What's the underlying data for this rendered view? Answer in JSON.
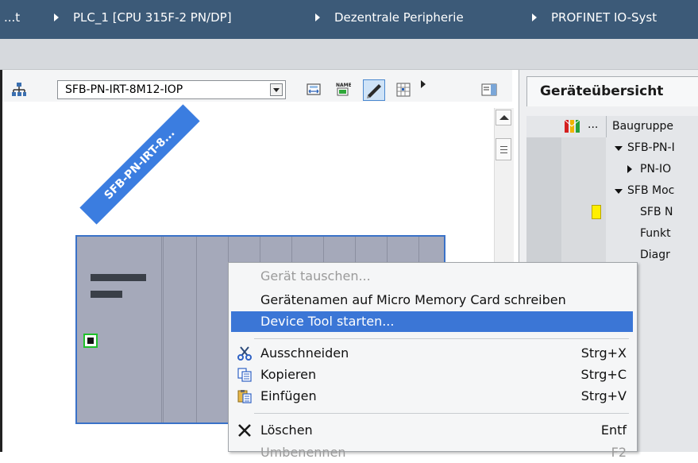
{
  "breadcrumb": {
    "items": [
      "...t",
      "PLC_1 [CPU 315F-2 PN/DP]",
      "Dezentrale Peripherie",
      "PROFINET IO-Syst"
    ]
  },
  "toolbar": {
    "device_select_value": "SFB-PN-IRT-8M12-IOP",
    "icons": [
      "network-view-icon",
      "device-select-icon",
      "zoom-fit-icon",
      "show-name-icon",
      "edit-icon",
      "grid-icon",
      "expand-arrow-icon",
      "panel-toggle-icon"
    ]
  },
  "canvas": {
    "device_label": "SFB-PN-IRT-8...",
    "port_color": "#1fc12a",
    "device_color": "#a5a9ba",
    "label_color": "#3b7de0"
  },
  "overview": {
    "tab_label": "Geräteübersicht",
    "header_ellipsis": "...",
    "header_col": "Baugruppe",
    "rows": [
      {
        "text": "SFB-PN-I",
        "expander": "down"
      },
      {
        "text": "PN-IO",
        "expander": "right"
      },
      {
        "text": "SFB Moc",
        "expander": "down"
      },
      {
        "text": "SFB N",
        "expander": "",
        "chip": true
      },
      {
        "text": "Funkt",
        "expander": ""
      },
      {
        "text": "Diagr",
        "expander": ""
      }
    ]
  },
  "context_menu": {
    "items": [
      {
        "label": "Gerät tauschen...",
        "shortcut": "",
        "state": "disabled",
        "icon": ""
      },
      {
        "label": "Gerätenamen auf Micro Memory Card schreiben",
        "shortcut": "",
        "state": "normal",
        "icon": ""
      },
      {
        "label": "Device Tool starten...",
        "shortcut": "",
        "state": "highlighted",
        "icon": ""
      },
      {
        "label": "Ausschneiden",
        "shortcut": "Strg+X",
        "state": "normal",
        "icon": "scissors-icon"
      },
      {
        "label": "Kopieren",
        "shortcut": "Strg+C",
        "state": "normal",
        "icon": "copy-icon"
      },
      {
        "label": "Einfügen",
        "shortcut": "Strg+V",
        "state": "normal",
        "icon": "paste-icon"
      },
      {
        "label": "Löschen",
        "shortcut": "Entf",
        "state": "normal",
        "icon": "delete-icon"
      },
      {
        "label": "Umbenennen",
        "shortcut": "F2",
        "state": "disabled",
        "icon": ""
      }
    ],
    "highlight_color": "#3b76d6"
  },
  "colors": {
    "titlebar": "#3c5a78",
    "accent": "#3b76d6"
  }
}
